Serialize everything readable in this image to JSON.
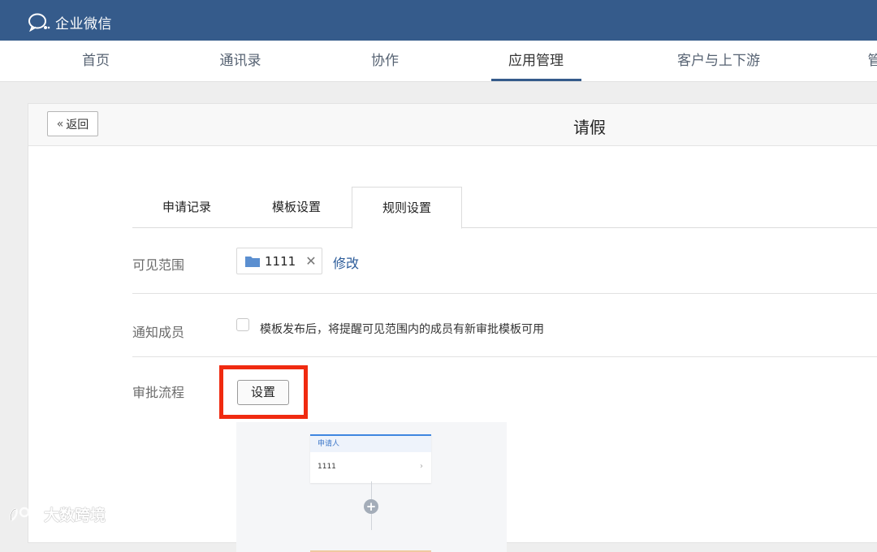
{
  "app": {
    "name": "企业微信"
  },
  "nav": {
    "items": [
      {
        "label": "首页"
      },
      {
        "label": "通讯录"
      },
      {
        "label": "协作"
      },
      {
        "label": "应用管理"
      },
      {
        "label": "客户与上下游"
      },
      {
        "label": "管"
      }
    ],
    "active_index": 3
  },
  "page": {
    "back_label": "返回",
    "title": "请假"
  },
  "tabs": [
    {
      "label": "申请记录"
    },
    {
      "label": "模板设置"
    },
    {
      "label": "规则设置"
    }
  ],
  "active_tab": 2,
  "form": {
    "visible_scope": {
      "label": "可见范围",
      "chip": "1111",
      "modify": "修改"
    },
    "notify": {
      "label": "通知成员",
      "checkbox_text": "模板发布后，将提醒可见范围内的成员有新审批模板可用",
      "checked": false
    },
    "approval_flow": {
      "label": "审批流程",
      "button": "设置"
    }
  },
  "flow_preview": {
    "card_title": "申请人",
    "card_value": "1111"
  },
  "watermark": {
    "text": "大数跨境"
  },
  "colors": {
    "topbar": "#355b8b",
    "link": "#2b5b99",
    "highlight": "#f02a10"
  }
}
